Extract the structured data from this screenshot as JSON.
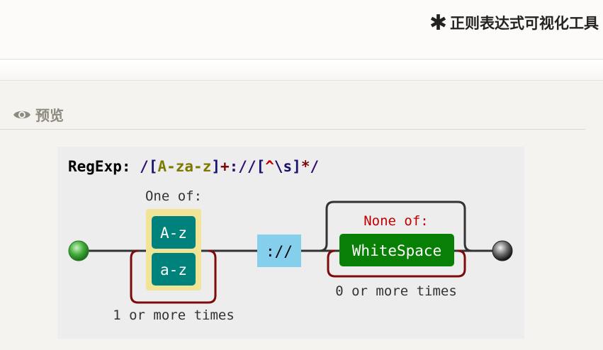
{
  "header": {
    "title": "正则表达式可视化工具",
    "star_glyph": "✱"
  },
  "preview": {
    "heading": "预览",
    "icon": "eye-icon"
  },
  "regexp": {
    "label": "RegExp:",
    "pattern_tokens": [
      {
        "text": "/",
        "role": "slash"
      },
      {
        "text": "[",
        "role": "bracket"
      },
      {
        "text": "A-za-z",
        "role": "range"
      },
      {
        "text": "]",
        "role": "bracket"
      },
      {
        "text": "+",
        "role": "quant"
      },
      {
        "text": "://",
        "role": "lit"
      },
      {
        "text": "[",
        "role": "bracket"
      },
      {
        "text": "^",
        "role": "caret"
      },
      {
        "text": "\\s",
        "role": "esc"
      },
      {
        "text": "]",
        "role": "bracket"
      },
      {
        "text": "*",
        "role": "quant"
      },
      {
        "text": "/",
        "role": "slash"
      }
    ]
  },
  "diagram": {
    "one_of_label": "One of:",
    "ranges": [
      "A-z",
      "a-z"
    ],
    "quant1_label": "1 or more times",
    "literal": "://",
    "none_of_label": "None of:",
    "whitespace": "WhiteSpace",
    "quant2_label": "0 or more times",
    "colors": {
      "charset_bg": "#f1e496",
      "range_box": "#00827c",
      "literal_box": "#85cfec",
      "negated_box": "#088005",
      "quant_loop": "#7d0b0b",
      "rail": "#333333",
      "none_of_text": "#c00000",
      "start_node": "#3aa33a",
      "end_node": "#333333"
    }
  }
}
